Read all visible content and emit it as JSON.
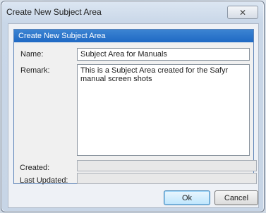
{
  "window": {
    "title": "Create New Subject Area",
    "close_glyph": "✕"
  },
  "panel": {
    "header": "Create New Subject Area"
  },
  "form": {
    "name_label": "Name:",
    "name_value": "Subject Area for Manuals",
    "remark_label": "Remark:",
    "remark_value": "This is a Subject Area created for the Safyr manual screen shots",
    "created_label": "Created:",
    "created_value": "",
    "last_updated_label": "Last Updated:",
    "last_updated_value": ""
  },
  "buttons": {
    "ok_label": "Ok",
    "cancel_label": "Cancel"
  },
  "colors": {
    "panel_header": "#1f69c4",
    "default_button": "#bee6fd"
  }
}
